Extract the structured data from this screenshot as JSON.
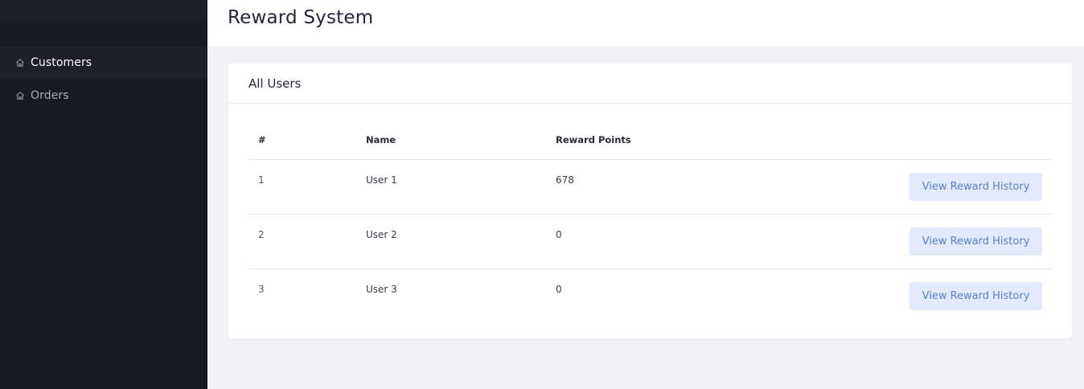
{
  "header": {
    "title": "Reward System"
  },
  "sidebar": {
    "items": [
      {
        "label": "Customers",
        "icon": "home-icon",
        "active": true
      },
      {
        "label": "Orders",
        "icon": "home-icon",
        "active": false
      }
    ]
  },
  "card": {
    "title": "All Users",
    "columns": {
      "id": "#",
      "name": "Name",
      "points": "Reward Points"
    },
    "rows": [
      {
        "id": "1",
        "name": "User 1",
        "points": "678",
        "action": "View Reward History"
      },
      {
        "id": "2",
        "name": "User 2",
        "points": "0",
        "action": "View Reward History"
      },
      {
        "id": "3",
        "name": "User 3",
        "points": "0",
        "action": "View Reward History"
      }
    ]
  },
  "colors": {
    "sidebar_bg": "#181826",
    "button_bg": "#e1ebfb",
    "button_text": "#5b82c9"
  }
}
